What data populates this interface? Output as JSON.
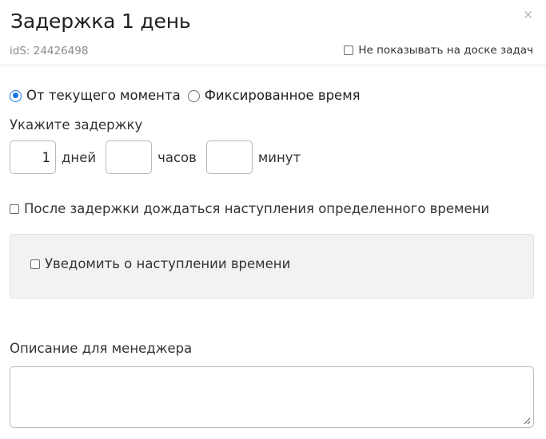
{
  "dialog": {
    "title": "Задержка 1 день",
    "close_icon": "×",
    "ids_label": "idS: 24426498",
    "hide_on_board_label": "Не показывать на доске задач"
  },
  "mode": {
    "options": [
      {
        "label": "От текущего момента",
        "checked": true
      },
      {
        "label": "Фиксированное время",
        "checked": false
      }
    ]
  },
  "delay": {
    "label": "Укажите задержку",
    "days_value": "1",
    "days_unit": "дней",
    "hours_value": "",
    "hours_unit": "часов",
    "minutes_value": "",
    "minutes_unit": "минут"
  },
  "wait_time": {
    "label": "После задержки дождаться наступления определенного времени",
    "checked": false
  },
  "notify": {
    "label": "Уведомить о наступлении времени",
    "checked": false
  },
  "description": {
    "label": "Описание для менеджера",
    "value": ""
  },
  "colors": {
    "accent": "#1a73e8",
    "panel_bg": "#f2f2f2",
    "muted_text": "#8a8a8a"
  }
}
